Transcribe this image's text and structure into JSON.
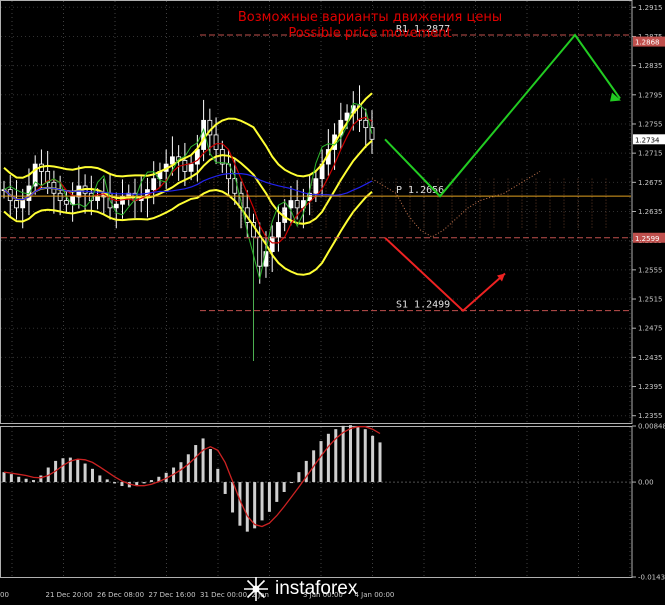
{
  "chart_data": {
    "type": "line",
    "title": "Возможные варианты движения цены",
    "subtitle": "Possible price movement",
    "price_axis": {
      "ylim": [
        1.2345,
        1.2925
      ],
      "ticks": [
        "1.2915",
        "1.2875",
        "1.2835",
        "1.2795",
        "1.2755",
        "1.2715",
        "1.2675",
        "1.2635",
        "1.2595",
        "1.2555",
        "1.2515",
        "1.2475",
        "1.2435",
        "1.2395",
        "1.2355"
      ]
    },
    "osc_axis": {
      "ylim": [
        -0.01436,
        0.00848
      ],
      "ticks": [
        "0.00848",
        "0.00",
        "-0.01436"
      ]
    },
    "time_ticks": [
      "00",
      "21 Dec 20:00",
      "26 Dec 08:00",
      "27 Dec 16:00",
      "31 Dec 00:00",
      "2 Jan",
      "3 Jan 00:00",
      "4 Jan 00:00",
      "",
      "",
      "",
      "",
      "",
      "",
      ""
    ],
    "levels": [
      {
        "name": "R1",
        "label": "R1 1.2877",
        "price": 1.2877,
        "color": "#c0504d"
      },
      {
        "name": "P",
        "label": "P 1.2656",
        "price": 1.2656,
        "color": "#e0a020"
      },
      {
        "name": "S1",
        "label": "S1 1.2499",
        "price": 1.2499,
        "color": "#c0504d"
      }
    ],
    "price_tags": [
      {
        "text": "1.2868",
        "price": 1.2868,
        "bg": "#c0504d",
        "fg": "#ffffff"
      },
      {
        "text": "1.2734",
        "price": 1.2734,
        "bg": "#ffffff",
        "fg": "#000000"
      },
      {
        "text": "1.2599",
        "price": 1.2599,
        "bg": "#c0504d",
        "fg": "#ffffff"
      }
    ],
    "close": [
      1.2665,
      1.265,
      1.264,
      1.265,
      1.267,
      1.27,
      1.269,
      1.2675,
      1.266,
      1.265,
      1.2645,
      1.2655,
      1.267,
      1.266,
      1.265,
      1.2655,
      1.266,
      1.264,
      1.2645,
      1.2655,
      1.266,
      1.265,
      1.2655,
      1.2665,
      1.268,
      1.269,
      1.27,
      1.271,
      1.2705,
      1.269,
      1.27,
      1.272,
      1.276,
      1.274,
      1.272,
      1.27,
      1.268,
      1.266,
      1.264,
      1.262,
      1.26,
      1.256,
      1.258,
      1.26,
      1.262,
      1.264,
      1.265,
      1.264,
      1.265,
      1.266,
      1.268,
      1.27,
      1.272,
      1.274,
      1.276,
      1.277,
      1.278,
      1.276,
      1.275,
      1.2734
    ],
    "ichimoku_ahead": [
      1.268,
      1.267,
      1.266,
      1.263,
      1.261,
      1.26,
      1.261,
      1.2625,
      1.264,
      1.265,
      1.2655,
      1.266,
      1.267,
      1.268,
      1.269
    ],
    "oscillator": [
      0.0015,
      0.0012,
      0.0008,
      0.0005,
      0.0003,
      0.001,
      0.0022,
      0.0032,
      0.0036,
      0.0037,
      0.0034,
      0.0028,
      0.002,
      0.001,
      0.0004,
      -0.0002,
      -0.0006,
      -0.0008,
      -0.0006,
      -0.0002,
      0.0003,
      0.0008,
      0.0014,
      0.0022,
      0.003,
      0.0042,
      0.0056,
      0.0066,
      0.005,
      0.002,
      -0.0018,
      -0.0046,
      -0.0066,
      -0.0075,
      -0.007,
      -0.0058,
      -0.0045,
      -0.003,
      -0.0015,
      0.0,
      0.0015,
      0.0032,
      0.0048,
      0.0062,
      0.0073,
      0.008,
      0.0085,
      0.0086,
      0.0084,
      0.008,
      0.007,
      0.006
    ],
    "forecast_up": [
      1.2734,
      1.2656,
      1.2877,
      1.279
    ],
    "forecast_down": [
      1.2599,
      1.2499,
      1.255
    ]
  },
  "brand": {
    "name": "instaforex"
  },
  "colors": {
    "bollinger": "#ffff33",
    "ma_red": "#cc0000",
    "ma_green": "#2db52d",
    "ma_blue": "#2222ee",
    "candle": "#ffffff",
    "up_arrow": "#22cc22",
    "down_arrow": "#ee2222",
    "osc_bar": "#d0d0d0",
    "osc_line": "#cc2222"
  }
}
